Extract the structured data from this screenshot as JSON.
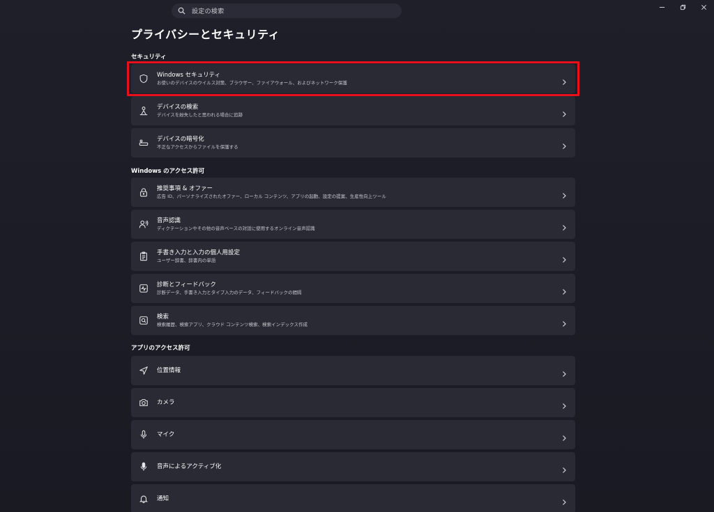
{
  "search": {
    "placeholder": "設定の検索"
  },
  "page": {
    "title": "プライバシーとセキュリティ"
  },
  "sections": {
    "security": "セキュリティ",
    "windows_access": "Windows のアクセス許可",
    "app_access": "アプリのアクセス許可"
  },
  "items": {
    "windows_security": {
      "title": "Windows セキュリティ",
      "desc": "お使いのデバイスのウイルス対策、ブラウザー、ファイアウォール、およびネットワーク保護"
    },
    "find_device": {
      "title": "デバイスの検索",
      "desc": "デバイスを紛失したと思われる場合に追跡"
    },
    "encryption": {
      "title": "デバイスの暗号化",
      "desc": "不正なアクセスからファイルを保護する"
    },
    "recommendations": {
      "title": "推奨事項 & オファー",
      "desc": "広告 ID、パーソナライズされたオファー、ローカル コンテンツ、アプリの起動、設定の提案、生産性向上ツール"
    },
    "speech": {
      "title": "音声認識",
      "desc": "ディクテーションやその他の音声ベースの対話に使用するオンライン音声認識"
    },
    "inking": {
      "title": "手書き入力と入力の個人用設定",
      "desc": "ユーザー辞書、辞書内の単語"
    },
    "diagnostics": {
      "title": "診断とフィードバック",
      "desc": "診断データ、手書き入力とタイプ入力のデータ、フィードバックの間隔"
    },
    "search_perm": {
      "title": "検索",
      "desc": "検索履歴、検索アプリ、クラウド コンテンツ検索、検索インデックス作成"
    },
    "location": {
      "title": "位置情報"
    },
    "camera": {
      "title": "カメラ"
    },
    "microphone": {
      "title": "マイク"
    },
    "voice_activation": {
      "title": "音声によるアクティブ化"
    },
    "notifications": {
      "title": "通知"
    }
  },
  "colors": {
    "highlight": "#e8101a",
    "card": "#2a2a34",
    "background": "#1c1c27"
  },
  "icons": {
    "search": "search-icon",
    "windows_security": "shield-icon",
    "find_device": "person-pin-icon",
    "encryption": "key-drive-icon",
    "recommendations": "lock-icon",
    "speech": "voice-person-icon",
    "inking": "clipboard-list-icon",
    "diagnostics": "pulse-icon",
    "search_perm": "search-box-icon",
    "location": "navigation-arrow-icon",
    "camera": "camera-icon",
    "microphone": "microphone-icon",
    "voice_activation": "microphone-voice-icon",
    "notifications": "bell-icon"
  }
}
